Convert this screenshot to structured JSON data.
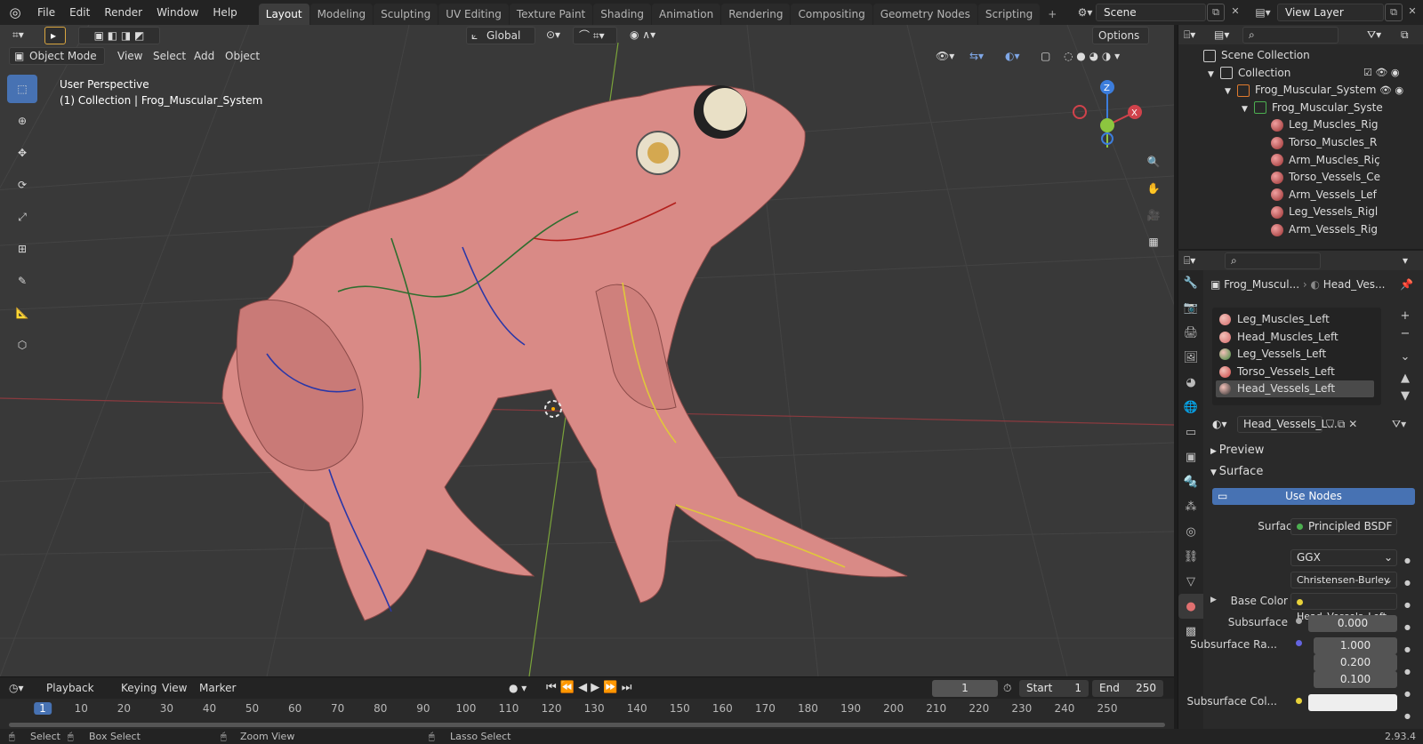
{
  "menubar": {
    "items": [
      "File",
      "Edit",
      "Render",
      "Window",
      "Help"
    ]
  },
  "workspaces": {
    "tabs": [
      "Layout",
      "Modeling",
      "Sculpting",
      "UV Editing",
      "Texture Paint",
      "Shading",
      "Animation",
      "Rendering",
      "Compositing",
      "Geometry Nodes",
      "Scripting"
    ],
    "active": "Layout",
    "add": "+"
  },
  "scene": {
    "name": "Scene"
  },
  "view_layer": {
    "name": "View Layer"
  },
  "viewport_header": {
    "mode": "Object Mode",
    "menus": [
      "View",
      "Select",
      "Add",
      "Object"
    ],
    "transform_orientation": "Global",
    "options": "Options"
  },
  "viewport_info": {
    "perspective": "User Perspective",
    "collection": "(1) Collection | Frog_Muscular_System"
  },
  "gizmo": {
    "z": "Z",
    "x": "X"
  },
  "outliner": {
    "rows": [
      {
        "label": "Scene Collection",
        "indent": 0
      },
      {
        "label": "Collection",
        "indent": 1
      },
      {
        "label": "Frog_Muscular_System",
        "indent": 2
      },
      {
        "label": "Frog_Muscular_Syste",
        "indent": 3
      },
      {
        "label": "Leg_Muscles_Rig",
        "indent": 4
      },
      {
        "label": "Torso_Muscles_R",
        "indent": 4
      },
      {
        "label": "Arm_Muscles_Riç",
        "indent": 4
      },
      {
        "label": "Torso_Vessels_Ce",
        "indent": 4
      },
      {
        "label": "Arm_Vessels_Lef",
        "indent": 4
      },
      {
        "label": "Leg_Vessels_Rigl",
        "indent": 4
      },
      {
        "label": "Arm_Vessels_Rig",
        "indent": 4
      }
    ]
  },
  "properties": {
    "breadcrumb_object": "Frog_Muscul...",
    "breadcrumb_material": "Head_Ves...",
    "material_slots": [
      "Leg_Muscles_Left",
      "Head_Muscles_Left",
      "Leg_Vessels_Left",
      "Torso_Vessels_Left",
      "Head_Vessels_Left"
    ],
    "active_slot": "Head_Vessels_Left",
    "material_name": "Head_Vessels_L...",
    "panel_preview": "Preview",
    "panel_surface": "Surface",
    "use_nodes": "Use Nodes",
    "surface_label": "Surface",
    "surface_value": "Principled BSDF",
    "distribution": "GGX",
    "subsurface_method": "Christensen-Burley",
    "base_color_label": "Base Color",
    "base_color_value": "Head_Vessels_Left...",
    "subsurface_label": "Subsurface",
    "subsurface_value": "0.000",
    "subsurface_radius_label": "Subsurface Ra...",
    "subsurface_radius": [
      "1.000",
      "0.200",
      "0.100"
    ],
    "subsurface_color_label": "Subsurface Col..."
  },
  "timeline": {
    "menus": [
      "Playback",
      "Keying",
      "View",
      "Marker"
    ],
    "current_frame": "1",
    "start_label": "Start",
    "start": "1",
    "end_label": "End",
    "end": "250",
    "ruler": [
      "1",
      "10",
      "20",
      "30",
      "40",
      "50",
      "60",
      "70",
      "80",
      "90",
      "100",
      "110",
      "120",
      "130",
      "140",
      "150",
      "160",
      "170",
      "180",
      "190",
      "200",
      "210",
      "220",
      "230",
      "240",
      "250"
    ]
  },
  "statusbar": {
    "select": "Select",
    "box_select": "Box Select",
    "zoom_view": "Zoom View",
    "lasso_select": "Lasso Select",
    "version": "2.93.4"
  },
  "colors": {
    "accent": "#4772b3",
    "viewport_bg": "#393939",
    "x_axis": "#d0424b",
    "y_axis": "#8cc63f",
    "z_axis": "#3c7ddc"
  }
}
